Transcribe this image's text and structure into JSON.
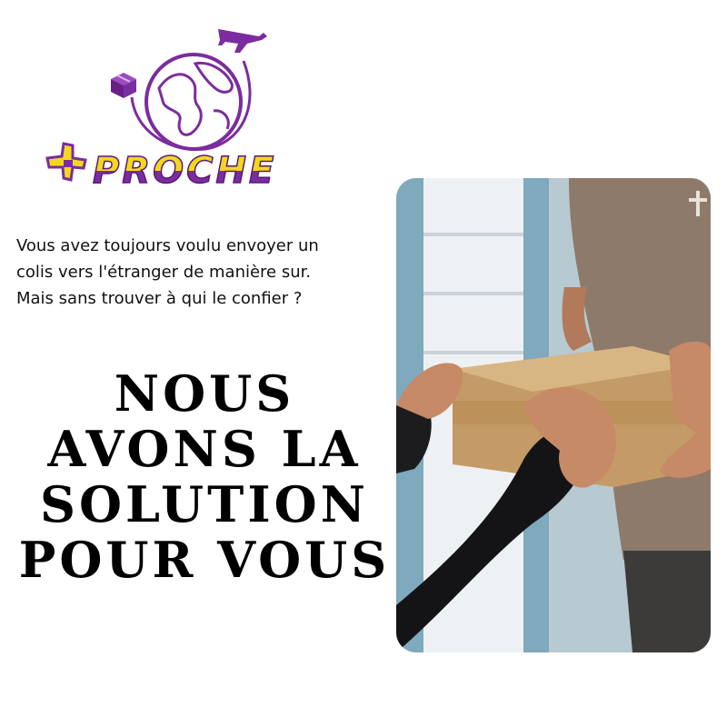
{
  "logo": {
    "wordmark": "PROCHE",
    "plus_icon": "plus-icon",
    "globe_icon": "globe-icon",
    "plane_icon": "airplane-icon",
    "box_icon": "parcel-box-icon",
    "colors": {
      "purple": "#7b2c9e",
      "yellow": "#f2d81d"
    }
  },
  "intro": {
    "line1": "Vous avez toujours voulu envoyer un",
    "line2": "colis vers l'étranger de manière sur.",
    "line3": "Mais sans trouver à qui le confier ?"
  },
  "headline": {
    "line1": "NOUS",
    "line2": "AVONS LA",
    "line3": "SOLUTION",
    "line4": "POUR VOUS"
  },
  "photo": {
    "subject": "parcel-handover-photo"
  }
}
